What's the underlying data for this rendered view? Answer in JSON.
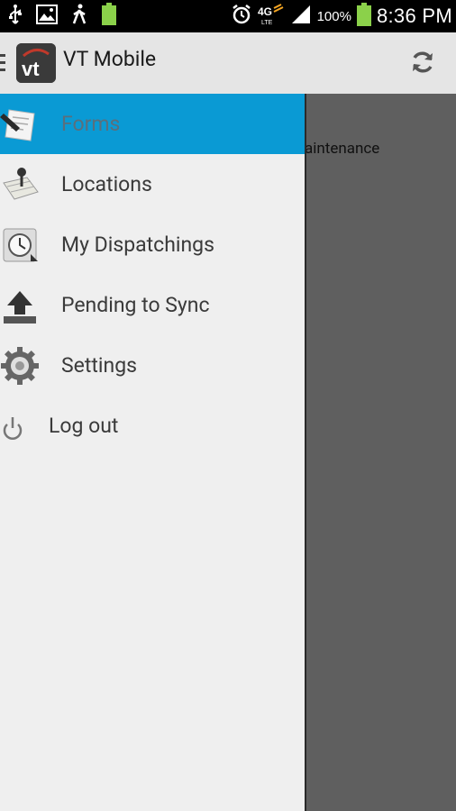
{
  "status_bar": {
    "battery_percent": "100%",
    "time": "8:36 PM",
    "network": "4G LTE"
  },
  "action_bar": {
    "title": "VT Mobile",
    "logo_text": "vt"
  },
  "background_content": {
    "partial_text": "aintenance"
  },
  "drawer": {
    "items": [
      {
        "label": "Forms",
        "icon": "forms-icon",
        "active": true
      },
      {
        "label": "Locations",
        "icon": "locations-icon",
        "active": false
      },
      {
        "label": "My Dispatchings",
        "icon": "dispatchings-icon",
        "active": false
      },
      {
        "label": "Pending to Sync",
        "icon": "upload-icon",
        "active": false
      },
      {
        "label": "Settings",
        "icon": "gear-icon",
        "active": false
      },
      {
        "label": "Log out",
        "icon": "power-icon",
        "active": false
      }
    ]
  },
  "colors": {
    "accent": "#0a9ad4",
    "drawer_bg": "#efefef",
    "actionbar_bg": "#e5e5e5",
    "scrim": "#5f5f5f"
  }
}
